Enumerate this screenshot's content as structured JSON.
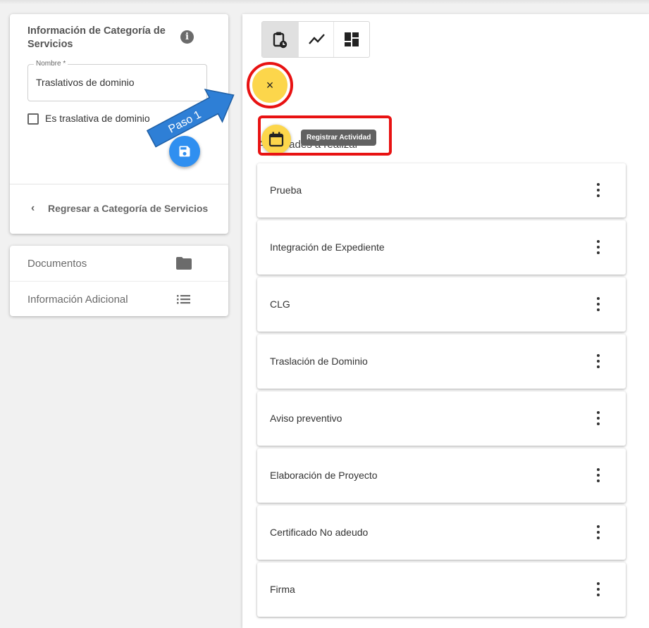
{
  "category_card": {
    "title": "Información de Categoría de Servicios",
    "info_glyph": "i",
    "name_field": {
      "label": "Nombre *",
      "value": "Traslativos de dominio"
    },
    "checkbox_label": "Es traslativa de dominio",
    "back_link": "Regresar a Categoría de Servicios"
  },
  "menu": {
    "items": [
      {
        "label": "Documentos",
        "icon": "folder-icon"
      },
      {
        "label": "Información Adicional",
        "icon": "list-icon"
      }
    ]
  },
  "toolbar": {
    "buttons": [
      {
        "icon": "clipboard-clock-icon",
        "active": true
      },
      {
        "icon": "trending-line-icon",
        "active": false
      },
      {
        "icon": "dashboard-grid-icon",
        "active": false
      }
    ]
  },
  "fab": {
    "close_glyph": "×"
  },
  "tooltip": {
    "text": "Registrar Actividad"
  },
  "activities": {
    "title": "Actividades a realizar",
    "items": [
      "Prueba",
      "Integración de Expediente",
      "CLG",
      "Traslación de Dominio",
      "Aviso preventivo",
      "Elaboración de Proyecto",
      "Certificado No adeudo",
      "Firma"
    ]
  },
  "annotation": {
    "arrow_label": "Paso 1"
  },
  "colors": {
    "fab_yellow": "#fcd64b",
    "save_blue": "#2f8ff0",
    "highlight_red": "#e81212",
    "arrow_blue": "#2e7fd6"
  }
}
